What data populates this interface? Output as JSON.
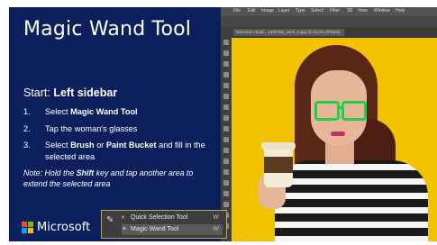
{
  "slide": {
    "title": "Magic Wand Tool",
    "start_prefix": "Start: ",
    "start_bold": "Left sidebar",
    "steps": [
      {
        "num": "1.",
        "pre": "Select ",
        "bold": "Magic Wand Tool",
        "post": "",
        "bold2": "",
        "post2": ""
      },
      {
        "num": "2.",
        "pre": "Tap the woman's glasses",
        "bold": "",
        "post": "",
        "bold2": "",
        "post2": ""
      },
      {
        "num": "3.",
        "pre": "Select ",
        "bold": "Brush",
        "post": " or ",
        "bold2": "Paint Bucket",
        "post2": " and fill in the selected area"
      }
    ],
    "note_pre": "Note: Hold the ",
    "note_bold": "Shift",
    "note_post": " key and tap another area to extend the selected area",
    "brand": "Microsoft"
  },
  "tool_popup": {
    "items": [
      {
        "label": "Quick Selection Tool",
        "key": "W"
      },
      {
        "label": "Magic Wand Tool",
        "key": "W"
      }
    ]
  },
  "photoshop": {
    "menu": [
      "File",
      "Edit",
      "Image",
      "Layer",
      "Type",
      "Select",
      "Filter",
      "3D",
      "View",
      "Window",
      "Help"
    ],
    "document_tab": "Selection Hand... 1405766_16x9_S.jpg @ 44.3% (RGB/8)"
  },
  "colors": {
    "panel_bg": "#0b1f5c",
    "canvas_bg": "#f2c200",
    "glasses": "#22d04b"
  }
}
